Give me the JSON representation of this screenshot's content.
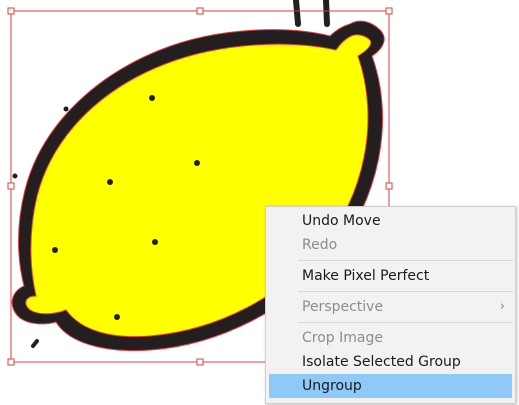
{
  "canvas": {
    "object_fill": "#ffff00",
    "outline_color": "#231f20",
    "selection_color": "#e03c3c",
    "object_icon": "lemon-icon"
  },
  "context_menu": {
    "items": [
      {
        "label": "Undo Move",
        "enabled": true
      },
      {
        "label": "Redo",
        "enabled": false
      },
      {
        "label": "Make Pixel Perfect",
        "enabled": true
      },
      {
        "label": "Perspective",
        "enabled": false,
        "submenu": true
      },
      {
        "label": "Crop Image",
        "enabled": false
      },
      {
        "label": "Isolate Selected Group",
        "enabled": true
      },
      {
        "label": "Ungroup",
        "enabled": true,
        "highlighted": true
      }
    ],
    "submenu_arrow": "›"
  }
}
